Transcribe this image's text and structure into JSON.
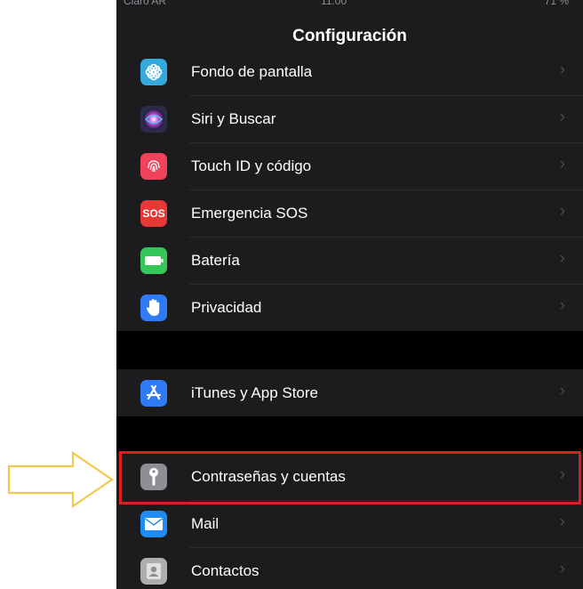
{
  "status": {
    "carrier": "Claro AR",
    "time": "11:00",
    "battery": "71 %"
  },
  "header": {
    "title": "Configuración"
  },
  "group1": [
    {
      "label": "Fondo de pantalla",
      "icon": "wallpaper-icon",
      "color": "#34aadc"
    },
    {
      "label": "Siri y Buscar",
      "icon": "siri-icon",
      "color": "#2b2b4a"
    },
    {
      "label": "Touch ID y código",
      "icon": "fingerprint-icon",
      "color": "#f0435a"
    },
    {
      "label": "Emergencia SOS",
      "icon": "sos-icon",
      "color": "#e53935",
      "icon_text": "SOS"
    },
    {
      "label": "Batería",
      "icon": "battery-icon",
      "color": "#34c759"
    },
    {
      "label": "Privacidad",
      "icon": "hand-icon",
      "color": "#2f7bf6"
    }
  ],
  "group2": [
    {
      "label": "iTunes y App Store",
      "icon": "app-store-icon",
      "color": "#2f7bf6"
    }
  ],
  "group3": [
    {
      "label": "Contraseñas y cuentas",
      "icon": "key-icon",
      "color": "#8e8e93"
    },
    {
      "label": "Mail",
      "icon": "mail-icon",
      "color": "#1f8cf5"
    },
    {
      "label": "Contactos",
      "icon": "contacts-icon",
      "color": "#aeaeae"
    }
  ],
  "annotations": {
    "highlight_color": "#d92020",
    "arrow_color": "#f2c94c"
  }
}
